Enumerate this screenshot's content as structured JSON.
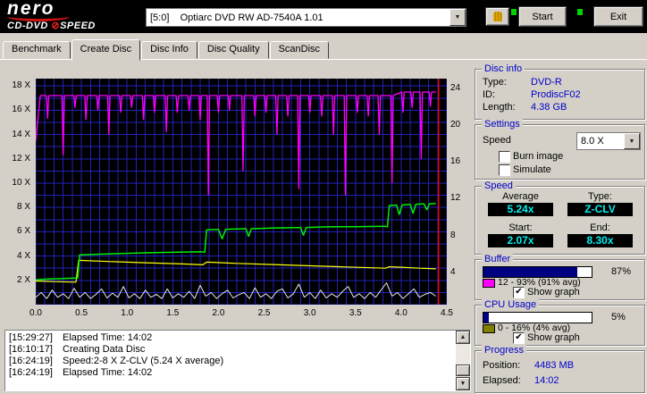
{
  "header": {
    "logo_line1": "nero",
    "logo_sub_left": "CD-DVD ",
    "logo_sub_o": "⊘",
    "logo_sub_right": "SPEED",
    "drive_select": "[5:0]    Optiarc DVD RW AD-7540A 1.01",
    "start_label": "Start",
    "exit_label": "Exit"
  },
  "icons": {
    "chevron_down": "▼",
    "check": "✔",
    "scroll_up": "▲",
    "scroll_down": "▼"
  },
  "tabs": [
    {
      "label": "Benchmark",
      "active": false
    },
    {
      "label": "Create Disc",
      "active": true
    },
    {
      "label": "Disc Info",
      "active": false
    },
    {
      "label": "Disc Quality",
      "active": false
    },
    {
      "label": "ScanDisc",
      "active": false
    }
  ],
  "graph": {
    "type": "line",
    "x_max": 4.5,
    "y_max": 18.6,
    "grid_x": 0.1,
    "grid_y": 1,
    "x_labels": [
      "0.0",
      "0.5",
      "1.0",
      "1.5",
      "2.0",
      "2.5",
      "3.0",
      "3.5",
      "4.0",
      "4.5"
    ],
    "y_left_labels": [
      "2 X",
      "4 X",
      "6 X",
      "8 X",
      "10 X",
      "12 X",
      "14 X",
      "16 X",
      "18 X"
    ],
    "y_right_labels": [
      "4",
      "8",
      "12",
      "16",
      "20",
      "24"
    ],
    "colors": {
      "plot_bg": "#000000",
      "grid": "#2222bb",
      "end_line": "#ff0000"
    },
    "end_line_x": 4.41,
    "series": [
      {
        "name": "cpu-usage",
        "color": "#e6e6e6",
        "width": 1,
        "points": [
          [
            0,
            0.6
          ],
          [
            0.06,
            1.0
          ],
          [
            0.12,
            0.5
          ],
          [
            0.18,
            1.2
          ],
          [
            0.24,
            0.6
          ],
          [
            0.3,
            0.9
          ],
          [
            0.36,
            0.5
          ],
          [
            0.42,
            1.35
          ],
          [
            0.48,
            0.6
          ],
          [
            0.54,
            1.0
          ],
          [
            0.6,
            0.5
          ],
          [
            0.66,
            0.85
          ],
          [
            0.72,
            1.3
          ],
          [
            0.78,
            0.55
          ],
          [
            0.84,
            0.95
          ],
          [
            0.9,
            0.6
          ],
          [
            0.96,
            1.5
          ],
          [
            1.02,
            0.55
          ],
          [
            1.08,
            0.9
          ],
          [
            1.14,
            0.5
          ],
          [
            1.2,
            1.2
          ],
          [
            1.26,
            0.6
          ],
          [
            1.32,
            0.85
          ],
          [
            1.38,
            0.5
          ],
          [
            1.44,
            1.3
          ],
          [
            1.5,
            0.55
          ],
          [
            1.56,
            0.9
          ],
          [
            1.62,
            0.6
          ],
          [
            1.68,
            1.1
          ],
          [
            1.74,
            0.5
          ],
          [
            1.8,
            1.6
          ],
          [
            1.86,
            0.7
          ],
          [
            1.92,
            1.0
          ],
          [
            1.98,
            0.5
          ],
          [
            2.04,
            0.9
          ],
          [
            2.1,
            1.2
          ],
          [
            2.16,
            0.55
          ],
          [
            2.22,
            0.8
          ],
          [
            2.28,
            1.0
          ],
          [
            2.34,
            0.5
          ],
          [
            2.4,
            1.4
          ],
          [
            2.46,
            0.6
          ],
          [
            2.52,
            0.9
          ],
          [
            2.58,
            0.5
          ],
          [
            2.64,
            1.1
          ],
          [
            2.7,
            1.3
          ],
          [
            2.76,
            0.55
          ],
          [
            2.82,
            0.9
          ],
          [
            2.88,
            1.7
          ],
          [
            2.94,
            0.6
          ],
          [
            3.0,
            1.0
          ],
          [
            3.06,
            0.5
          ],
          [
            3.12,
            1.2
          ],
          [
            3.18,
            0.55
          ],
          [
            3.24,
            0.9
          ],
          [
            3.3,
            0.6
          ],
          [
            3.36,
            1.1
          ],
          [
            3.42,
            1.5
          ],
          [
            3.48,
            0.6
          ],
          [
            3.54,
            0.9
          ],
          [
            3.6,
            0.5
          ],
          [
            3.66,
            1.0
          ],
          [
            3.72,
            0.6
          ],
          [
            3.78,
            1.2
          ],
          [
            3.84,
            1.8
          ],
          [
            3.9,
            0.7
          ],
          [
            3.96,
            1.0
          ],
          [
            4.02,
            0.5
          ],
          [
            4.08,
            0.9
          ],
          [
            4.14,
            1.3
          ],
          [
            4.2,
            0.6
          ],
          [
            4.26,
            0.85
          ],
          [
            4.32,
            1.0
          ],
          [
            4.38,
            0.7
          ]
        ]
      },
      {
        "name": "buffer-level",
        "color": "#ff00ff",
        "width": 1.3,
        "type": "spiky",
        "base": 17.2,
        "base2": 17.5,
        "base2_from": 3.95,
        "start": [
          0,
          13.5
        ],
        "end_x": 4.38,
        "halfwidth": 0.013,
        "dips": [
          [
            0.13,
            15.3
          ],
          [
            0.3,
            12.3
          ],
          [
            0.43,
            16.2
          ],
          [
            0.55,
            15.2
          ],
          [
            0.68,
            16.0
          ],
          [
            0.8,
            14.0
          ],
          [
            0.93,
            15.8
          ],
          [
            1.05,
            16.2
          ],
          [
            1.18,
            15.2
          ],
          [
            1.3,
            15.8
          ],
          [
            1.43,
            14.2
          ],
          [
            1.55,
            15.8
          ],
          [
            1.68,
            16.0
          ],
          [
            1.8,
            15.2
          ],
          [
            1.89,
            9.0
          ],
          [
            2.0,
            15.8
          ],
          [
            2.12,
            16.0
          ],
          [
            2.27,
            11.0
          ],
          [
            2.4,
            15.5
          ],
          [
            2.52,
            15.8
          ],
          [
            2.64,
            14.0
          ],
          [
            2.76,
            15.5
          ],
          [
            2.88,
            9.5
          ],
          [
            3.0,
            15.8
          ],
          [
            3.13,
            15.5
          ],
          [
            3.26,
            14.0
          ],
          [
            3.39,
            9.0
          ],
          [
            3.52,
            15.8
          ],
          [
            3.64,
            15.5
          ],
          [
            3.76,
            14.0
          ],
          [
            3.9,
            10.0
          ],
          [
            4.02,
            15.8
          ],
          [
            4.12,
            16.2
          ],
          [
            4.22,
            12.0
          ],
          [
            4.32,
            16.3
          ]
        ]
      },
      {
        "name": "rotation-speed",
        "color": "#ffff00",
        "width": 1.2,
        "points": [
          [
            0,
            1.95
          ],
          [
            0.2,
            1.9
          ],
          [
            0.44,
            1.85
          ],
          [
            0.47,
            3.65
          ],
          [
            0.8,
            3.55
          ],
          [
            1.2,
            3.45
          ],
          [
            1.6,
            3.35
          ],
          [
            1.83,
            3.28
          ],
          [
            1.87,
            3.5
          ],
          [
            2.2,
            3.4
          ],
          [
            2.6,
            3.3
          ],
          [
            3.0,
            3.2
          ],
          [
            3.4,
            3.1
          ],
          [
            3.83,
            3.0
          ],
          [
            3.87,
            3.12
          ],
          [
            4.0,
            3.08
          ],
          [
            4.2,
            3.0
          ],
          [
            4.38,
            2.95
          ]
        ]
      },
      {
        "name": "write-speed",
        "color": "#00ee00",
        "width": 1.5,
        "points": [
          [
            0,
            2.05
          ],
          [
            0.12,
            2.1
          ],
          [
            0.3,
            2.15
          ],
          [
            0.46,
            2.2
          ],
          [
            0.48,
            4.1
          ],
          [
            0.9,
            4.2
          ],
          [
            1.3,
            4.28
          ],
          [
            1.82,
            4.35
          ],
          [
            1.85,
            4.3
          ],
          [
            1.87,
            6.15
          ],
          [
            2.0,
            6.2
          ],
          [
            2.04,
            5.4
          ],
          [
            2.08,
            6.2
          ],
          [
            2.3,
            6.25
          ],
          [
            2.33,
            5.6
          ],
          [
            2.36,
            6.25
          ],
          [
            2.6,
            6.3
          ],
          [
            2.9,
            6.35
          ],
          [
            2.93,
            5.7
          ],
          [
            2.96,
            6.35
          ],
          [
            3.2,
            6.4
          ],
          [
            3.5,
            6.42
          ],
          [
            3.82,
            6.45
          ],
          [
            3.85,
            6.4
          ],
          [
            3.87,
            8.15
          ],
          [
            3.95,
            8.2
          ],
          [
            3.98,
            7.4
          ],
          [
            4.01,
            8.2
          ],
          [
            4.1,
            8.25
          ],
          [
            4.13,
            7.5
          ],
          [
            4.16,
            8.25
          ],
          [
            4.25,
            8.3
          ],
          [
            4.28,
            7.8
          ],
          [
            4.31,
            8.3
          ],
          [
            4.38,
            8.32
          ]
        ]
      }
    ]
  },
  "disc_info": {
    "title": "Disc info",
    "rows": [
      {
        "label": "Type:",
        "value": "DVD-R"
      },
      {
        "label": "ID:",
        "value": "ProdiscF02"
      },
      {
        "label": "Length:",
        "value": "4.38 GB"
      }
    ]
  },
  "settings": {
    "title": "Settings",
    "speed_label": "Speed",
    "speed_value": "8.0 X",
    "checkboxes": [
      {
        "label": "Burn image",
        "checked": false
      },
      {
        "label": "Simulate",
        "checked": false
      }
    ]
  },
  "speed_box": {
    "title": "Speed",
    "average_label": "Average",
    "average_value": "5.24x",
    "type_label": "Type:",
    "type_value": "Z-CLV",
    "start_label": "Start:",
    "start_value": "2.07x",
    "end_label": "End:",
    "end_value": "8.30x"
  },
  "buffer": {
    "title": "Buffer",
    "percent": "87%",
    "fill": 87,
    "swatch_color": "#ff00ff",
    "range_text": "12 - 93%  (91% avg)",
    "show_graph_label": "Show graph",
    "show_graph_checked": true
  },
  "cpu": {
    "title": "CPU Usage",
    "percent": "5%",
    "fill": 5,
    "swatch_color": "#808000",
    "range_text": "0 - 16%  (4% avg)",
    "show_graph_label": "Show graph",
    "show_graph_checked": true
  },
  "progress": {
    "title": "Progress",
    "position_label": "Position:",
    "position_value": "4483 MB",
    "elapsed_label": "Elapsed:",
    "elapsed_value": "14:02"
  },
  "log": {
    "lines": [
      {
        "time": "[15:29:27]",
        "text": "Elapsed Time: 14:02"
      },
      {
        "time": "[16:10:17]",
        "text": "Creating Data Disc"
      },
      {
        "time": "[16:24:19]",
        "text": "Speed:2-8 X Z-CLV (5.24 X average)"
      },
      {
        "time": "[16:24:19]",
        "text": "Elapsed Time: 14:02"
      }
    ]
  }
}
